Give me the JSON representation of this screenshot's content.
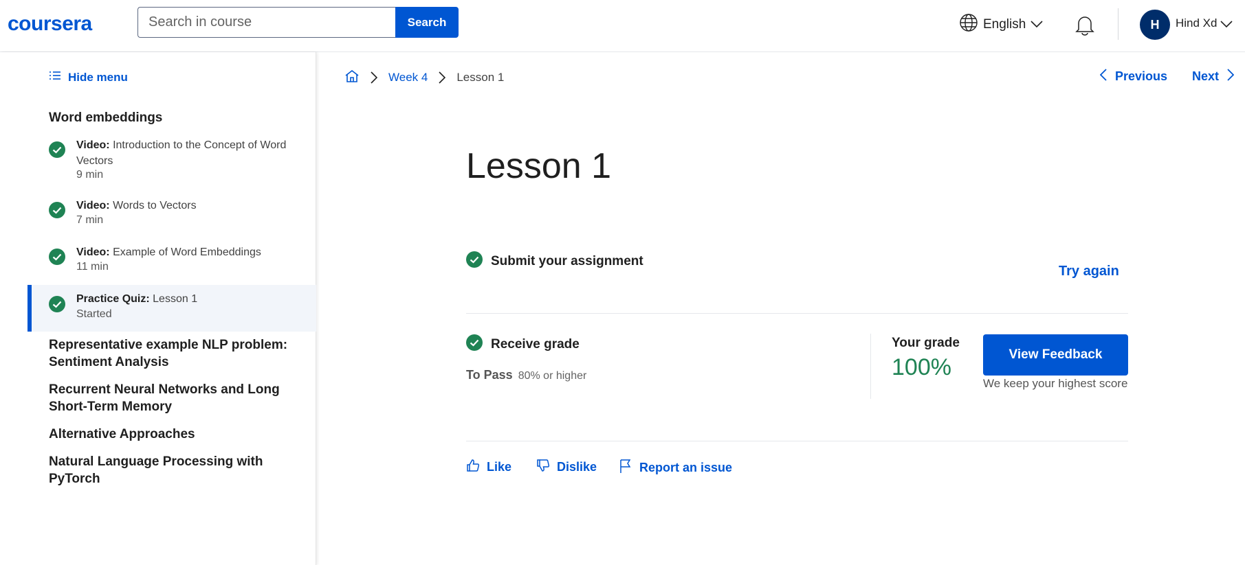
{
  "header": {
    "logo": "coursera",
    "search_placeholder": "Search in course",
    "search_button": "Search",
    "language": "English",
    "avatar_initial": "H",
    "username": "Hind Xd",
    "brand_color": "#0056d2"
  },
  "sidebar": {
    "hide_menu": "Hide menu",
    "current_section": "Word embeddings",
    "items": [
      {
        "type": "Video:",
        "title": "Introduction to the Concept of Word Vectors",
        "meta": "9 min",
        "completed": true
      },
      {
        "type": "Video:",
        "title": "Words to Vectors",
        "meta": "7 min",
        "completed": true
      },
      {
        "type": "Video:",
        "title": "Example of Word Embeddings",
        "meta": "11 min",
        "completed": true
      },
      {
        "type": "Practice Quiz:",
        "title": "Lesson 1",
        "meta": "Started",
        "completed": true,
        "active": true
      }
    ],
    "other_sections": [
      "Representative example NLP problem: Sentiment Analysis",
      "Recurrent Neural Networks and Long Short-Term Memory",
      "Alternative Approaches",
      "Natural Language Processing with PyTorch"
    ]
  },
  "breadcrumb": {
    "week": "Week 4",
    "current": "Lesson 1"
  },
  "nav": {
    "previous": "Previous",
    "next": "Next"
  },
  "main": {
    "title": "Lesson 1",
    "submit_label": "Submit your assignment",
    "try_again": "Try again",
    "receive_grade": "Receive grade",
    "to_pass_label": "To Pass",
    "to_pass_value": "80% or higher",
    "your_grade_label": "Your grade",
    "grade": "100%",
    "view_feedback": "View Feedback",
    "keep_score": "We keep your highest score",
    "like": "Like",
    "dislike": "Dislike",
    "report": "Report an issue",
    "success_color": "#1f8354"
  }
}
